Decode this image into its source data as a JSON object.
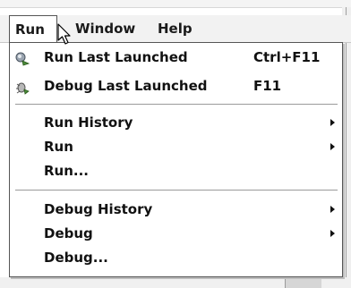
{
  "menubar": {
    "items": [
      {
        "label": "Run",
        "active": true
      },
      {
        "label": "Window",
        "active": false
      },
      {
        "label": "Help",
        "active": false
      }
    ]
  },
  "menu": {
    "run_last_launched": {
      "label": "Run Last Launched",
      "shortcut": "Ctrl+F11",
      "icon": "run-icon"
    },
    "debug_last_launched": {
      "label": "Debug Last Launched",
      "shortcut": "F11",
      "icon": "debug-icon"
    },
    "run_history": {
      "label": "Run History",
      "icon": "submenu-arrow-icon"
    },
    "run": {
      "label": "Run",
      "icon": "submenu-arrow-icon"
    },
    "run_dialog": {
      "label": "Run..."
    },
    "debug_history": {
      "label": "Debug History",
      "icon": "submenu-arrow-icon"
    },
    "debug": {
      "label": "Debug",
      "icon": "submenu-arrow-icon"
    },
    "debug_dialog": {
      "label": "Debug..."
    }
  },
  "colors": {
    "menu_background": "#ffffff",
    "menubar_background": "#f2f2f2",
    "text": "#111111",
    "border": "#555555"
  }
}
